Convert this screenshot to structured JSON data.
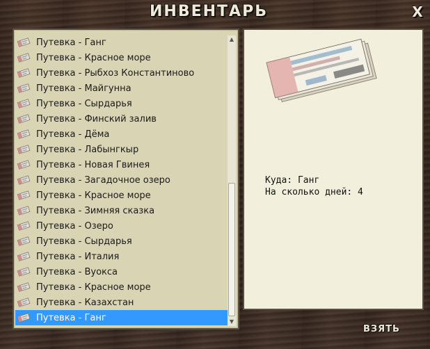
{
  "window": {
    "title": "ИНВЕНТАРЬ",
    "close_label": "X"
  },
  "inventory": {
    "items": [
      {
        "label": "Путевка - Ганг",
        "icon": "ticket-icon"
      },
      {
        "label": "Путевка - Красное море",
        "icon": "ticket-icon"
      },
      {
        "label": "Путевка - Рыбхоз Константиново",
        "icon": "ticket-icon"
      },
      {
        "label": "Путевка - Майгунна",
        "icon": "ticket-icon"
      },
      {
        "label": "Путевка - Сырдарья",
        "icon": "ticket-icon"
      },
      {
        "label": "Путевка - Финский залив",
        "icon": "ticket-icon"
      },
      {
        "label": "Путевка - Дёма",
        "icon": "ticket-icon"
      },
      {
        "label": "Путевка - Лабынгкыр",
        "icon": "ticket-icon"
      },
      {
        "label": "Путевка - Новая Гвинея",
        "icon": "ticket-icon"
      },
      {
        "label": "Путевка - Загадочное озеро",
        "icon": "ticket-icon"
      },
      {
        "label": "Путевка - Красное море",
        "icon": "ticket-icon"
      },
      {
        "label": "Путевка - Зимняя сказка",
        "icon": "ticket-icon"
      },
      {
        "label": "Путевка - Озеро",
        "icon": "ticket-icon"
      },
      {
        "label": "Путевка - Сырдарья",
        "icon": "ticket-icon"
      },
      {
        "label": "Путевка - Италия",
        "icon": "ticket-icon"
      },
      {
        "label": "Путевка - Вуокса",
        "icon": "ticket-icon"
      },
      {
        "label": "Путевка - Красное море",
        "icon": "ticket-icon"
      },
      {
        "label": "Путевка - Казахстан",
        "icon": "ticket-icon"
      },
      {
        "label": "Путевка - Ганг",
        "icon": "ticket-icon"
      }
    ],
    "selected_index": 18
  },
  "detail": {
    "destination_line": "Куда: Ганг",
    "days_line": "На сколько дней: 4"
  },
  "actions": {
    "take_label": "ВЗЯТЬ"
  },
  "colors": {
    "selection": "#3399ff",
    "list_bg": "#d9d4b3",
    "detail_bg": "#f2f0dd"
  }
}
